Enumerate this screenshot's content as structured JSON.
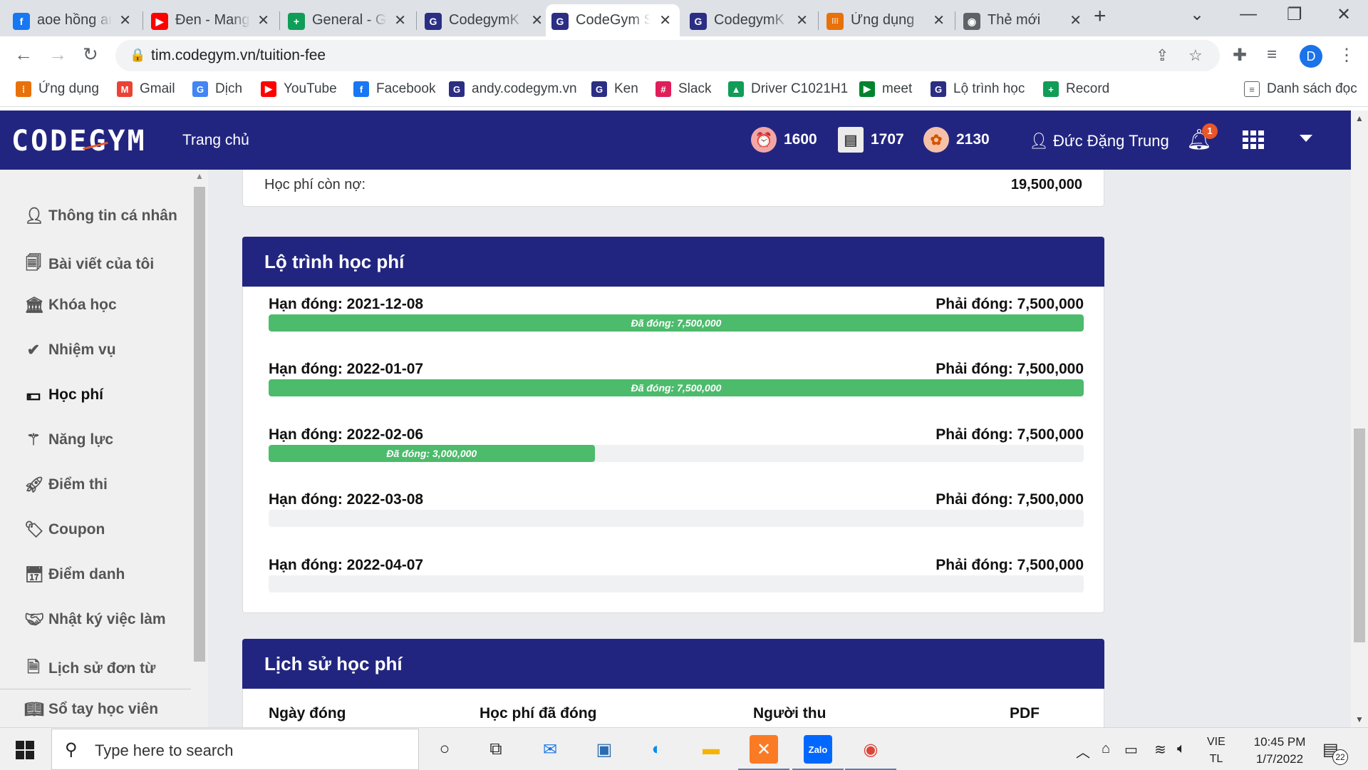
{
  "browser": {
    "tabs": [
      {
        "title": "aoe hồng an",
        "color": "#1877f2",
        "glyph": "f"
      },
      {
        "title": "Đen - Mang",
        "color": "#ff0000",
        "glyph": "▶"
      },
      {
        "title": "General - G",
        "color": "#0f9d58",
        "glyph": "+"
      },
      {
        "title": "CodegymK",
        "color": "#2b2e83",
        "glyph": "G"
      },
      {
        "title": "CodeGym S",
        "color": "#2b2e83",
        "glyph": "G"
      },
      {
        "title": "CodegymK",
        "color": "#2b2e83",
        "glyph": "G"
      },
      {
        "title": "Ứng dụng",
        "color": "#e8710a",
        "glyph": "⁞⁞⁞"
      },
      {
        "title": "Thẻ mới",
        "color": "#5f6368",
        "glyph": "◉"
      }
    ],
    "url": "tim.codegym.vn/tuition-fee",
    "profile_initial": "D",
    "bookmarks": [
      {
        "label": "Ứng dụng",
        "color": "#e8710a",
        "glyph": "⁞"
      },
      {
        "label": "Gmail",
        "color": "#ea4335",
        "glyph": "M"
      },
      {
        "label": "Dịch",
        "color": "#4285f4",
        "glyph": "G"
      },
      {
        "label": "YouTube",
        "color": "#ff0000",
        "glyph": "▶"
      },
      {
        "label": "Facebook",
        "color": "#1877f2",
        "glyph": "f"
      },
      {
        "label": "andy.codegym.vn",
        "color": "#2b2e83",
        "glyph": "G"
      },
      {
        "label": "Ken",
        "color": "#2b2e83",
        "glyph": "G"
      },
      {
        "label": "Slack",
        "color": "#e01e5a",
        "glyph": "#"
      },
      {
        "label": "Driver C1021H1",
        "color": "#0f9d58",
        "glyph": "▲"
      },
      {
        "label": "meet",
        "color": "#00832d",
        "glyph": "▶"
      },
      {
        "label": "Lộ trình học",
        "color": "#2b2e83",
        "glyph": "G"
      },
      {
        "label": "Record",
        "color": "#0f9d58",
        "glyph": "+"
      }
    ],
    "reading_list": "Danh sách đọc"
  },
  "header": {
    "logo": "CODEGYM",
    "home": "Trang chủ",
    "stats": [
      {
        "icon": "alarm-clock-icon",
        "value": "1600"
      },
      {
        "icon": "certificate-icon",
        "value": "1707"
      },
      {
        "icon": "brain-icon",
        "value": "2130"
      }
    ],
    "user": "Đức Đặng Trung",
    "notifications": "1"
  },
  "sidebar": {
    "items": [
      {
        "label": "Thông tin cá nhân",
        "icon": "user-icon"
      },
      {
        "label": "Bài viết của tôi",
        "icon": "documents-icon"
      },
      {
        "label": "Khóa học",
        "icon": "institution-icon"
      },
      {
        "label": "Nhiệm vụ",
        "icon": "check-icon"
      },
      {
        "label": "Học phí",
        "icon": "money-icon"
      },
      {
        "label": "Năng lực",
        "icon": "magic-wand-icon"
      },
      {
        "label": "Điểm thi",
        "icon": "rocket-icon"
      },
      {
        "label": "Coupon",
        "icon": "tag-icon"
      },
      {
        "label": "Điểm danh",
        "icon": "calendar-icon"
      },
      {
        "label": "Nhật ký việc làm",
        "icon": "handshake-icon"
      },
      {
        "label": "Lịch sử đơn từ",
        "icon": "file-icon"
      },
      {
        "label": "Sổ tay học viên",
        "icon": "book-icon"
      }
    ],
    "active_index": 4
  },
  "debt": {
    "label": "Học phí còn nợ:",
    "value": "19,500,000"
  },
  "plan": {
    "title": "Lộ trình học phí",
    "installments": [
      {
        "due": "Hạn đóng: 2021-12-08",
        "must": "Phải đóng: 7,500,000",
        "paid_label": "Đã đóng: 7,500,000",
        "paid_ratio": 1.0
      },
      {
        "due": "Hạn đóng: 2022-01-07",
        "must": "Phải đóng: 7,500,000",
        "paid_label": "Đã đóng: 7,500,000",
        "paid_ratio": 1.0
      },
      {
        "due": "Hạn đóng: 2022-02-06",
        "must": "Phải đóng: 7,500,000",
        "paid_label": "Đã đóng: 3,000,000",
        "paid_ratio": 0.4
      },
      {
        "due": "Hạn đóng: 2022-03-08",
        "must": "Phải đóng: 7,500,000",
        "paid_label": "",
        "paid_ratio": 0
      },
      {
        "due": "Hạn đóng: 2022-04-07",
        "must": "Phải đóng: 7,500,000",
        "paid_label": "",
        "paid_ratio": 0
      }
    ]
  },
  "history": {
    "title": "Lịch sử học phí",
    "columns": [
      "Ngày đóng",
      "Học phí đã đóng",
      "Người thu",
      "PDF"
    ]
  },
  "taskbar": {
    "search_placeholder": "Type here to search",
    "lang": [
      "VIE",
      "TL"
    ],
    "time": "10:45 PM",
    "date": "1/7/2022",
    "notification_count": "22"
  }
}
